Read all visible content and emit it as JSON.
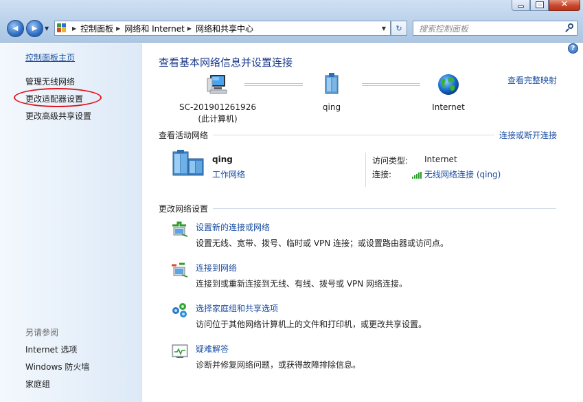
{
  "window": {
    "minimize_icon": "minimize-icon",
    "maximize_icon": "maximize-icon",
    "close_icon": "close-icon",
    "close_glyph": "✕"
  },
  "navigation": {
    "back_glyph": "◀",
    "forward_glyph": "▶",
    "breadcrumbs": [
      "控制面板",
      "网络和 Internet",
      "网络和共享中心"
    ],
    "search_placeholder": "搜索控制面板",
    "refresh_glyph": "↻"
  },
  "sidebar": {
    "home_link": "控制面板主页",
    "items": [
      "管理无线网络",
      "更改适配器设置",
      "更改高级共享设置"
    ],
    "see_also_title": "另请参阅",
    "see_also": [
      "Internet 选项",
      "Windows 防火墙",
      "家庭组"
    ],
    "annotation": "red-ellipse around 更改适配器设置"
  },
  "main": {
    "title": "查看基本网络信息并设置连接",
    "full_map_link": "查看完整映射",
    "help_glyph": "?",
    "map_nodes": [
      {
        "line1": "SC-201901261926",
        "line2": "(此计算机)",
        "icon": "computer-icon"
      },
      {
        "line1": "qing",
        "line2": "",
        "icon": "network-icon"
      },
      {
        "line1": "Internet",
        "line2": "",
        "icon": "globe-icon"
      }
    ],
    "active_networks": {
      "title": "查看活动网络",
      "connect_disconnect_link": "连接或断开连接",
      "network_name": "qing",
      "network_type": "工作网络",
      "access_type_label": "访问类型:",
      "access_type_value": "Internet",
      "connections_label": "连接:",
      "connections_value": "无线网络连接 (qing)"
    },
    "change_settings": {
      "title": "更改网络设置",
      "tasks": [
        {
          "link": "设置新的连接或网络",
          "desc": "设置无线、宽带、拨号、临时或 VPN 连接；或设置路由器或访问点。",
          "icon": "new-connection-icon"
        },
        {
          "link": "连接到网络",
          "desc": "连接到或重新连接到无线、有线、拨号或 VPN 网络连接。",
          "icon": "connect-network-icon"
        },
        {
          "link": "选择家庭组和共享选项",
          "desc": "访问位于其他网络计算机上的文件和打印机，或更改共享设置。",
          "icon": "homegroup-icon"
        },
        {
          "link": "疑难解答",
          "desc": "诊断并修复网络问题，或获得故障排除信息。",
          "icon": "troubleshoot-icon"
        }
      ]
    }
  },
  "colors": {
    "link": "#1e50a2",
    "title": "#1e3c8c",
    "annotation": "#e0141b"
  }
}
